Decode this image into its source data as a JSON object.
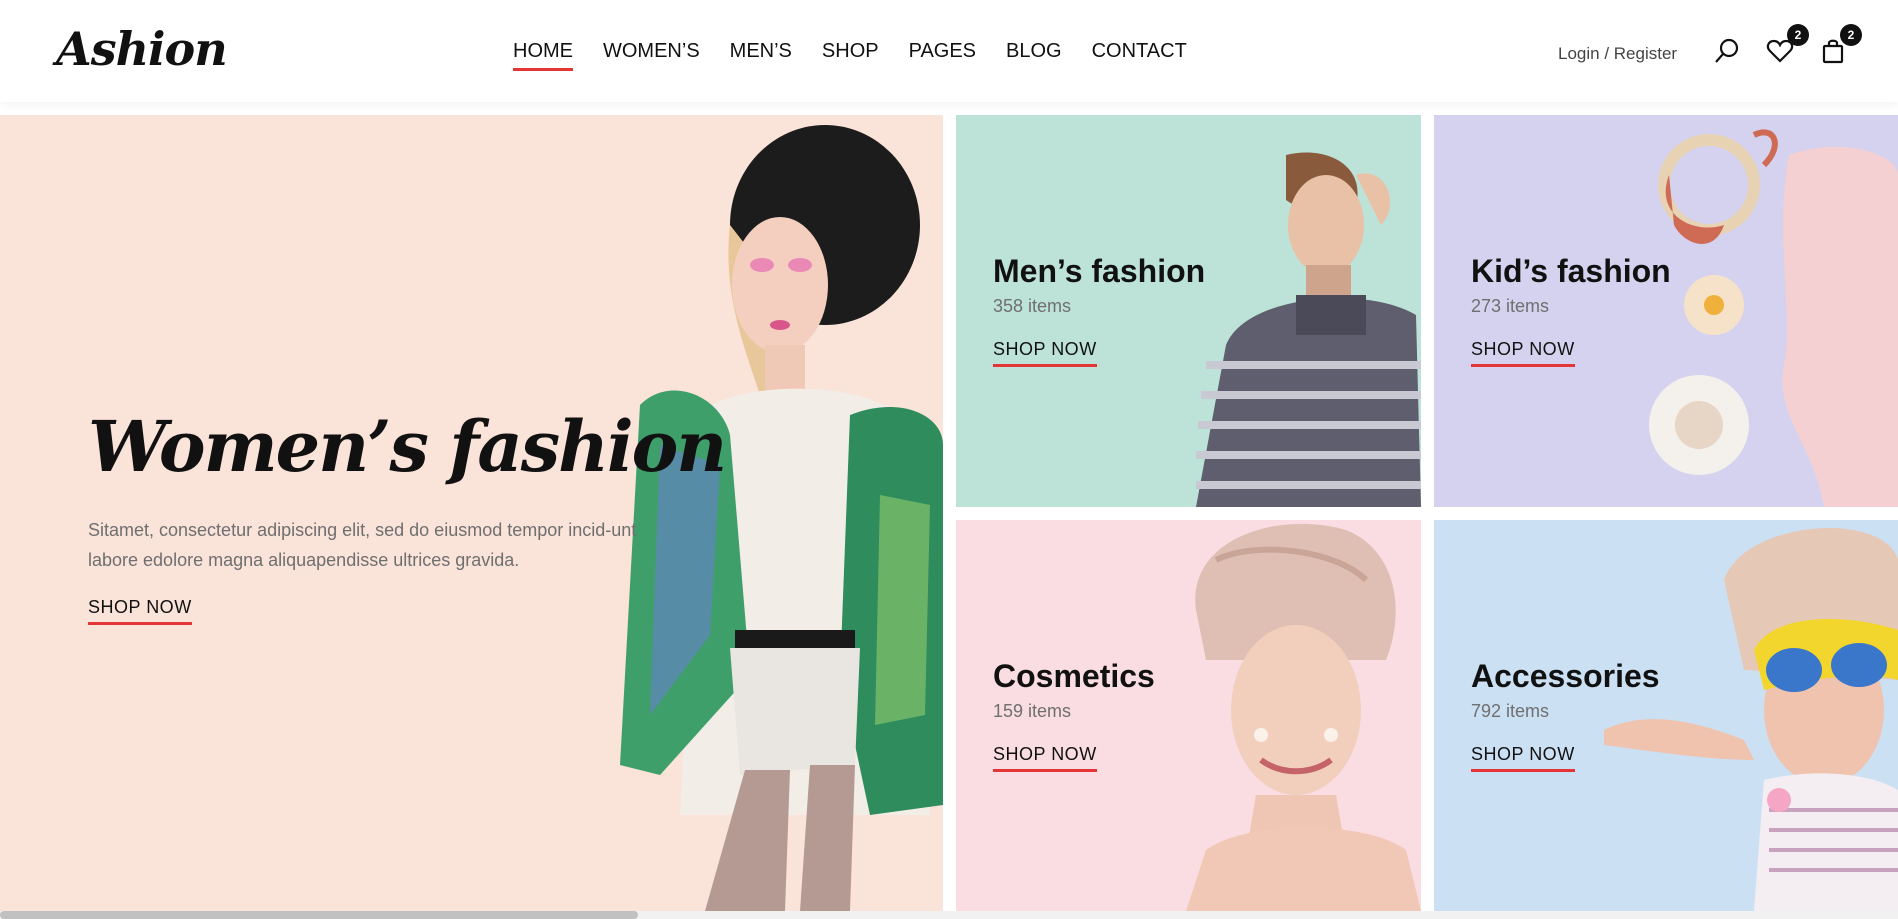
{
  "brand": {
    "logo": "Ashion"
  },
  "nav": {
    "items": [
      {
        "label": "HOME",
        "active": true
      },
      {
        "label": "WOMEN’S",
        "active": false
      },
      {
        "label": "MEN’S",
        "active": false
      },
      {
        "label": "SHOP",
        "active": false
      },
      {
        "label": "PAGES",
        "active": false
      },
      {
        "label": "BLOG",
        "active": false
      },
      {
        "label": "CONTACT",
        "active": false
      }
    ]
  },
  "header": {
    "auth_label": "Login / Register",
    "icons": {
      "search": "search-icon",
      "wishlist": "heart-icon",
      "cart": "shopping-bag-icon"
    },
    "wishlist_count": "2",
    "cart_count": "2"
  },
  "hero": {
    "title": "Women’s fashion",
    "description": "Sitamet, consectetur adipiscing elit, sed do eiusmod tempor incid-unt labore edolore magna aliquapendisse ultrices gravida.",
    "cta": "SHOP NOW",
    "background": "#fae3d9"
  },
  "categories": [
    {
      "title": "Men’s fashion",
      "count": "358 items",
      "cta": "SHOP NOW",
      "background": "#bde3d8"
    },
    {
      "title": "Kid’s fashion",
      "count": "273 items",
      "cta": "SHOP NOW",
      "background": "#d4d2ee"
    },
    {
      "title": "Cosmetics",
      "count": "159 items",
      "cta": "SHOP NOW",
      "background": "#fadde3"
    },
    {
      "title": "Accessories",
      "count": "792 items",
      "cta": "SHOP NOW",
      "background": "#cce0f4"
    }
  ],
  "colors": {
    "accent": "#e53637",
    "text": "#111111",
    "muted": "#6f6f6f"
  }
}
